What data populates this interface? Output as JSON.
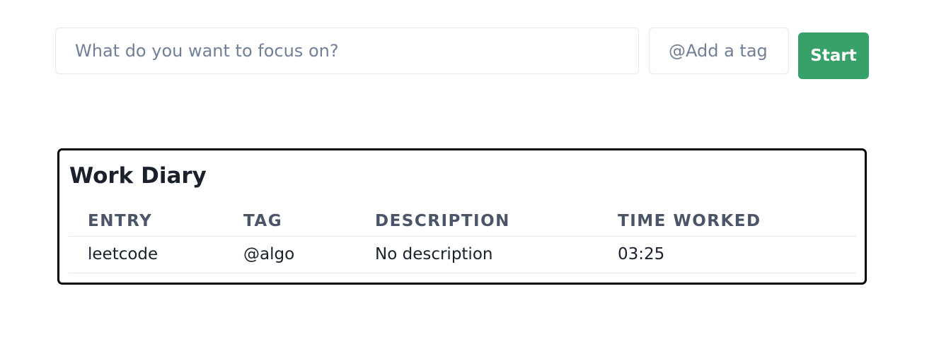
{
  "toolbar": {
    "focus_placeholder": "What do you want to focus on?",
    "focus_value": "",
    "tag_placeholder": "@Add a tag",
    "tag_value": "",
    "start_label": "Start"
  },
  "diary": {
    "title": "Work Diary",
    "columns": {
      "entry": "ENTRY",
      "tag": "TAG",
      "description": "DESCRIPTION",
      "time_worked": "TIME WORKED"
    },
    "rows": [
      {
        "entry": "leetcode",
        "tag": "@algo",
        "description": "No description",
        "time_worked": "03:25"
      }
    ]
  },
  "colors": {
    "start_button": "#38a169",
    "card_border": "#000000",
    "header_text": "#4a5568"
  }
}
